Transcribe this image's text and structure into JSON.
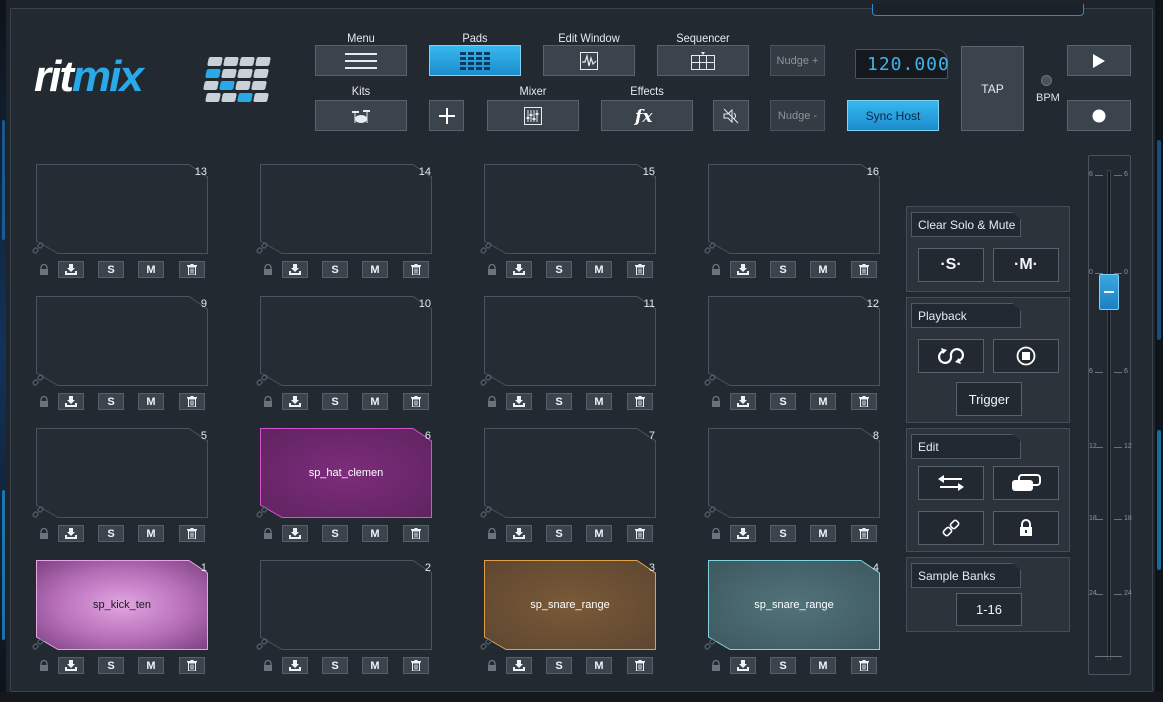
{
  "logo": {
    "text_white": "rit",
    "text_blue": "mix"
  },
  "toolbar": {
    "menu_label": "Menu",
    "pads_label": "Pads",
    "edit_window_label": "Edit Window",
    "sequencer_label": "Sequencer",
    "kits_label": "Kits",
    "mixer_label": "Mixer",
    "effects_label": "Effects",
    "nudge_plus": "Nudge +",
    "nudge_minus": "Nudge -",
    "sync_host": "Sync Host",
    "bpm_value": "120.000",
    "tap": "TAP",
    "bpm_label": "BPM"
  },
  "pad_controls": {
    "solo": "S",
    "mute": "M"
  },
  "pads": [
    {
      "number": "13",
      "name": ""
    },
    {
      "number": "14",
      "name": ""
    },
    {
      "number": "15",
      "name": ""
    },
    {
      "number": "16",
      "name": ""
    },
    {
      "number": "9",
      "name": ""
    },
    {
      "number": "10",
      "name": ""
    },
    {
      "number": "11",
      "name": ""
    },
    {
      "number": "12",
      "name": ""
    },
    {
      "number": "5",
      "name": ""
    },
    {
      "number": "6",
      "name": "sp_hat_clemen",
      "color": "#8a2e86"
    },
    {
      "number": "7",
      "name": ""
    },
    {
      "number": "8",
      "name": ""
    },
    {
      "number": "1",
      "name": "sp_kick_ten",
      "color": "#c986c9"
    },
    {
      "number": "2",
      "name": ""
    },
    {
      "number": "3",
      "name": "sp_snare_range",
      "color": "#7a5a36"
    },
    {
      "number": "4",
      "name": "sp_snare_range",
      "color": "#4a6870"
    }
  ],
  "panels": {
    "clear_solo_mute": {
      "title": "Clear Solo & Mute",
      "solo_btn": "·S·",
      "mute_btn": "·M·"
    },
    "playback": {
      "title": "Playback",
      "trigger": "Trigger"
    },
    "edit": {
      "title": "Edit"
    },
    "sample_banks": {
      "title": "Sample Banks",
      "bank": "1-16"
    }
  },
  "fader": {
    "ticks": [
      "6",
      "0",
      "6",
      "12",
      "18",
      "24"
    ],
    "level": 0.24
  },
  "colors": {
    "accent": "#29a9e8",
    "pad_6": "#8a2e86",
    "pad_1": "#c986c9",
    "pad_3": "#7a5a36",
    "pad_4": "#4a6870"
  }
}
